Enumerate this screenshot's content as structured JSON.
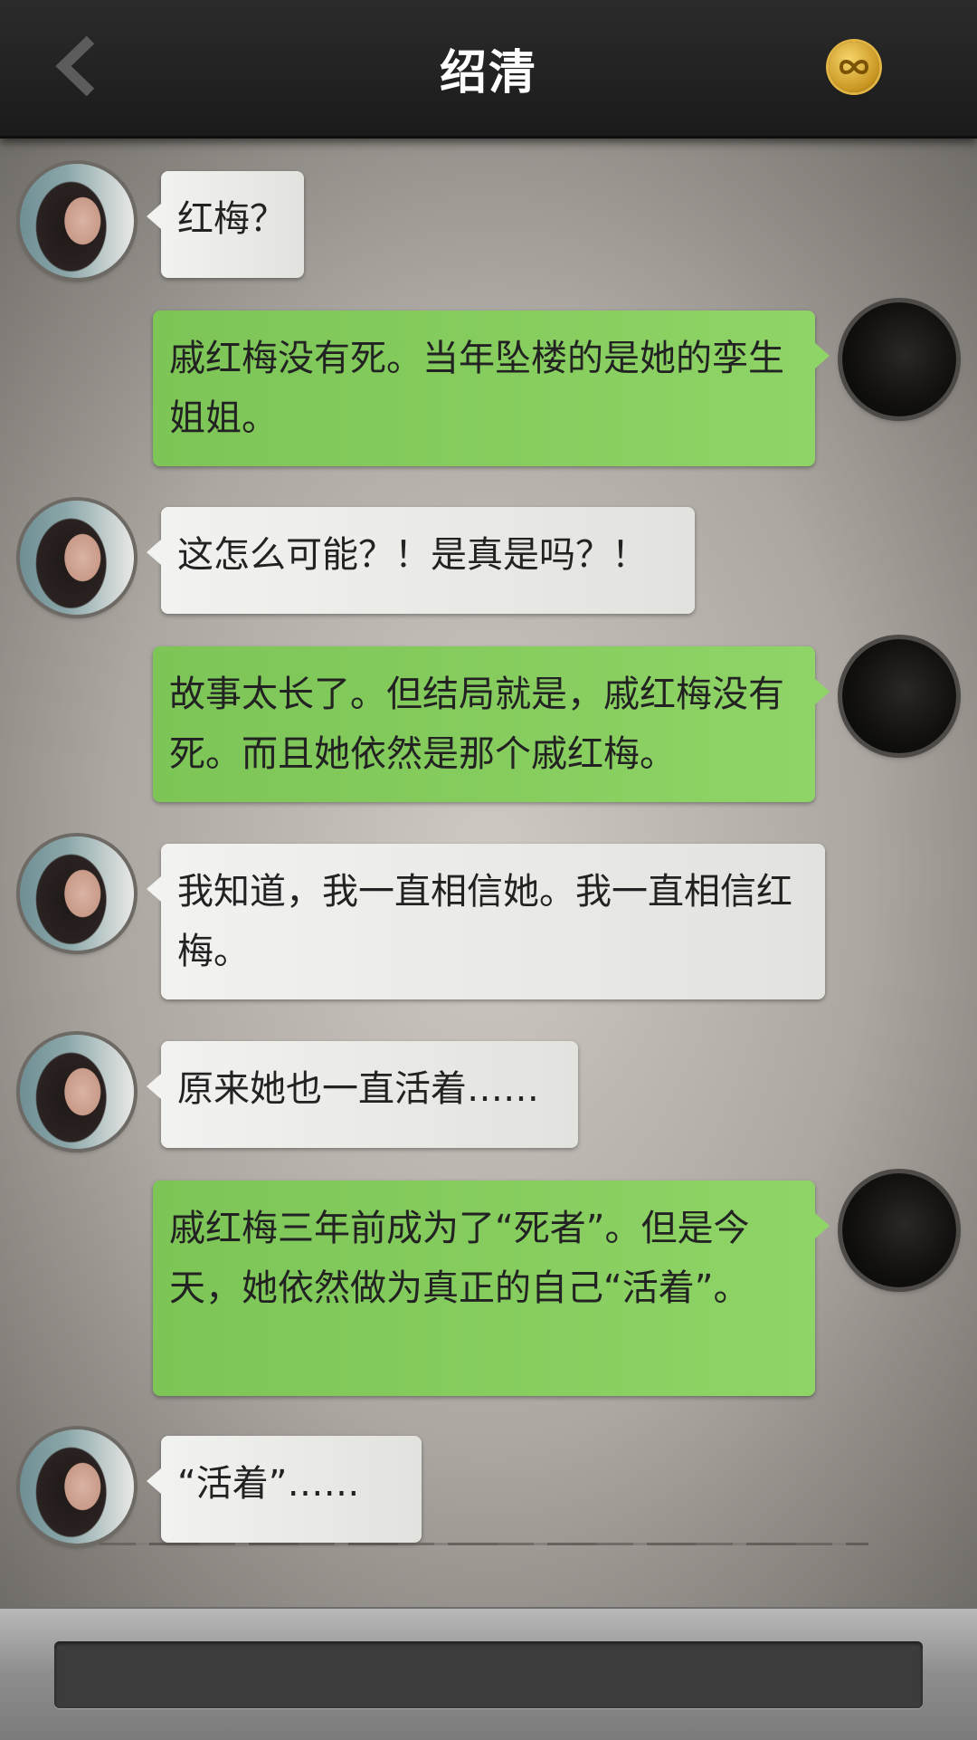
{
  "header": {
    "title": "绍清",
    "back_icon": "chevron-left-icon",
    "coin_icon": "infinity-coin-icon"
  },
  "messages": [
    {
      "side": "left",
      "text": "红梅？"
    },
    {
      "side": "right",
      "text": "戚红梅没有死。当年坠楼的是她的孪生姐姐。"
    },
    {
      "side": "left",
      "text": "这怎么可能？！是真是吗？！"
    },
    {
      "side": "right",
      "text": "故事太长了。但结局就是，戚红梅没有死。而且她依然是那个戚红梅。"
    },
    {
      "side": "left",
      "text": "我知道，我一直相信她。我一直相信红梅。"
    },
    {
      "side": "left",
      "text": "原来她也一直活着……"
    },
    {
      "side": "right",
      "text": "戚红梅三年前成为了“死者”。但是今天，她依然做为真正的自己“活着”。"
    },
    {
      "side": "left",
      "text": "“活着”……"
    }
  ],
  "footer": {
    "input_value": ""
  }
}
